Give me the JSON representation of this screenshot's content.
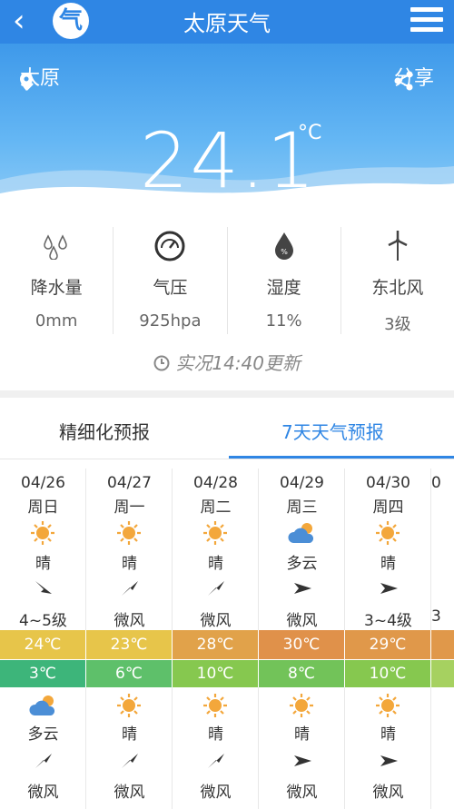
{
  "header": {
    "back": "‹",
    "logo": "气",
    "title": "太原天气"
  },
  "location": {
    "city": "太原",
    "share": "分享"
  },
  "current": {
    "temp": "24.1",
    "unit": "°C"
  },
  "stats": [
    {
      "label": "降水量",
      "value": "0mm",
      "icon": "rain-drops-icon"
    },
    {
      "label": "气压",
      "value": "925hpa",
      "icon": "gauge-icon"
    },
    {
      "label": "湿度",
      "value": "11%",
      "icon": "humidity-icon"
    },
    {
      "label": "东北风",
      "value": "3级",
      "icon": "wind-turbine-icon"
    }
  ],
  "update": "实况14:40更新",
  "tabs": {
    "fine": "精细化预报",
    "week": "7天天气预报"
  },
  "days": [
    {
      "date": "04/26",
      "weekday": "周日",
      "day_weather": "晴",
      "day_icon": "sun",
      "day_wind": "4~5级",
      "high": "24℃",
      "high_color": "#e7c54a",
      "low": "3℃",
      "low_color": "#3db57a",
      "night_weather": "多云",
      "night_icon": "cloud",
      "night_wind": "微风"
    },
    {
      "date": "04/27",
      "weekday": "周一",
      "day_weather": "晴",
      "day_icon": "sun",
      "day_wind": "微风",
      "high": "23℃",
      "high_color": "#e7c54a",
      "low": "6℃",
      "low_color": "#5ec06a",
      "night_weather": "晴",
      "night_icon": "sun",
      "night_wind": "微风"
    },
    {
      "date": "04/28",
      "weekday": "周二",
      "day_weather": "晴",
      "day_icon": "sun",
      "day_wind": "微风",
      "high": "28℃",
      "high_color": "#e1a24a",
      "low": "10℃",
      "low_color": "#86c84f",
      "night_weather": "晴",
      "night_icon": "sun",
      "night_wind": "微风"
    },
    {
      "date": "04/29",
      "weekday": "周三",
      "day_weather": "多云",
      "day_icon": "cloud",
      "day_wind": "微风",
      "high": "30℃",
      "high_color": "#e0914a",
      "low": "8℃",
      "low_color": "#72c359",
      "night_weather": "晴",
      "night_icon": "sun",
      "night_wind": "微风"
    },
    {
      "date": "04/30",
      "weekday": "周四",
      "day_weather": "晴",
      "day_icon": "sun",
      "day_wind": "3~4级",
      "high": "29℃",
      "high_color": "#e0984a",
      "low": "10℃",
      "low_color": "#86c84f",
      "night_weather": "晴",
      "night_icon": "sun",
      "night_wind": "微风"
    },
    {
      "date": "0",
      "weekday": "",
      "day_weather": "",
      "day_icon": "",
      "day_wind": "3",
      "high": "",
      "high_color": "#e0984a",
      "low": "",
      "low_color": "#a6d160",
      "night_weather": "",
      "night_icon": "",
      "night_wind": ""
    }
  ],
  "colors": {
    "brand": "#2f86e4",
    "icon": "#f0a832"
  }
}
